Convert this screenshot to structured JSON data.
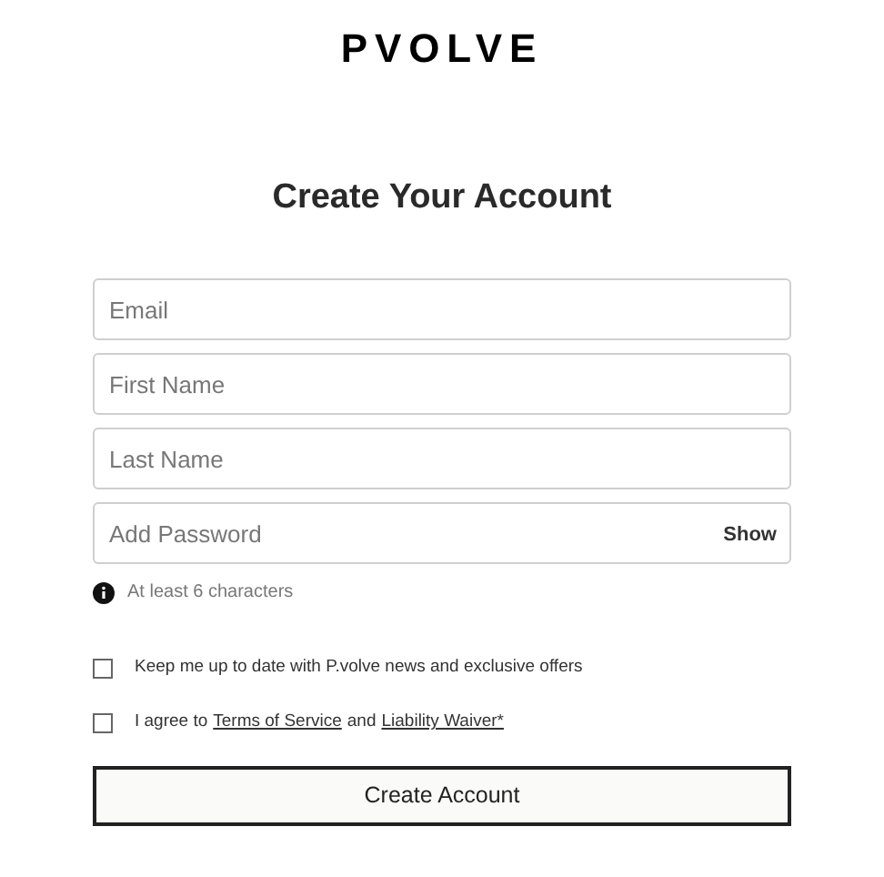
{
  "logo": "PVOLVE",
  "title": "Create Your Account",
  "fields": [
    {
      "placeholder": "Email"
    },
    {
      "placeholder": "First Name"
    },
    {
      "placeholder": "Last Name"
    },
    {
      "placeholder": "Add Password",
      "action": "Show"
    }
  ],
  "hint": "At least 6 characters",
  "checkboxes": [
    {
      "checked": false,
      "parts": [
        {
          "kind": "text",
          "text": "Keep me up to date with P.volve news and exclusive offers"
        }
      ]
    },
    {
      "checked": false,
      "parts": [
        {
          "kind": "text",
          "text": "I agree to"
        },
        {
          "kind": "link",
          "text": "Terms of Service"
        },
        {
          "kind": "text",
          "text": "and"
        },
        {
          "kind": "link",
          "text": "Liability Waiver*"
        }
      ]
    }
  ],
  "submit": "Create Account"
}
